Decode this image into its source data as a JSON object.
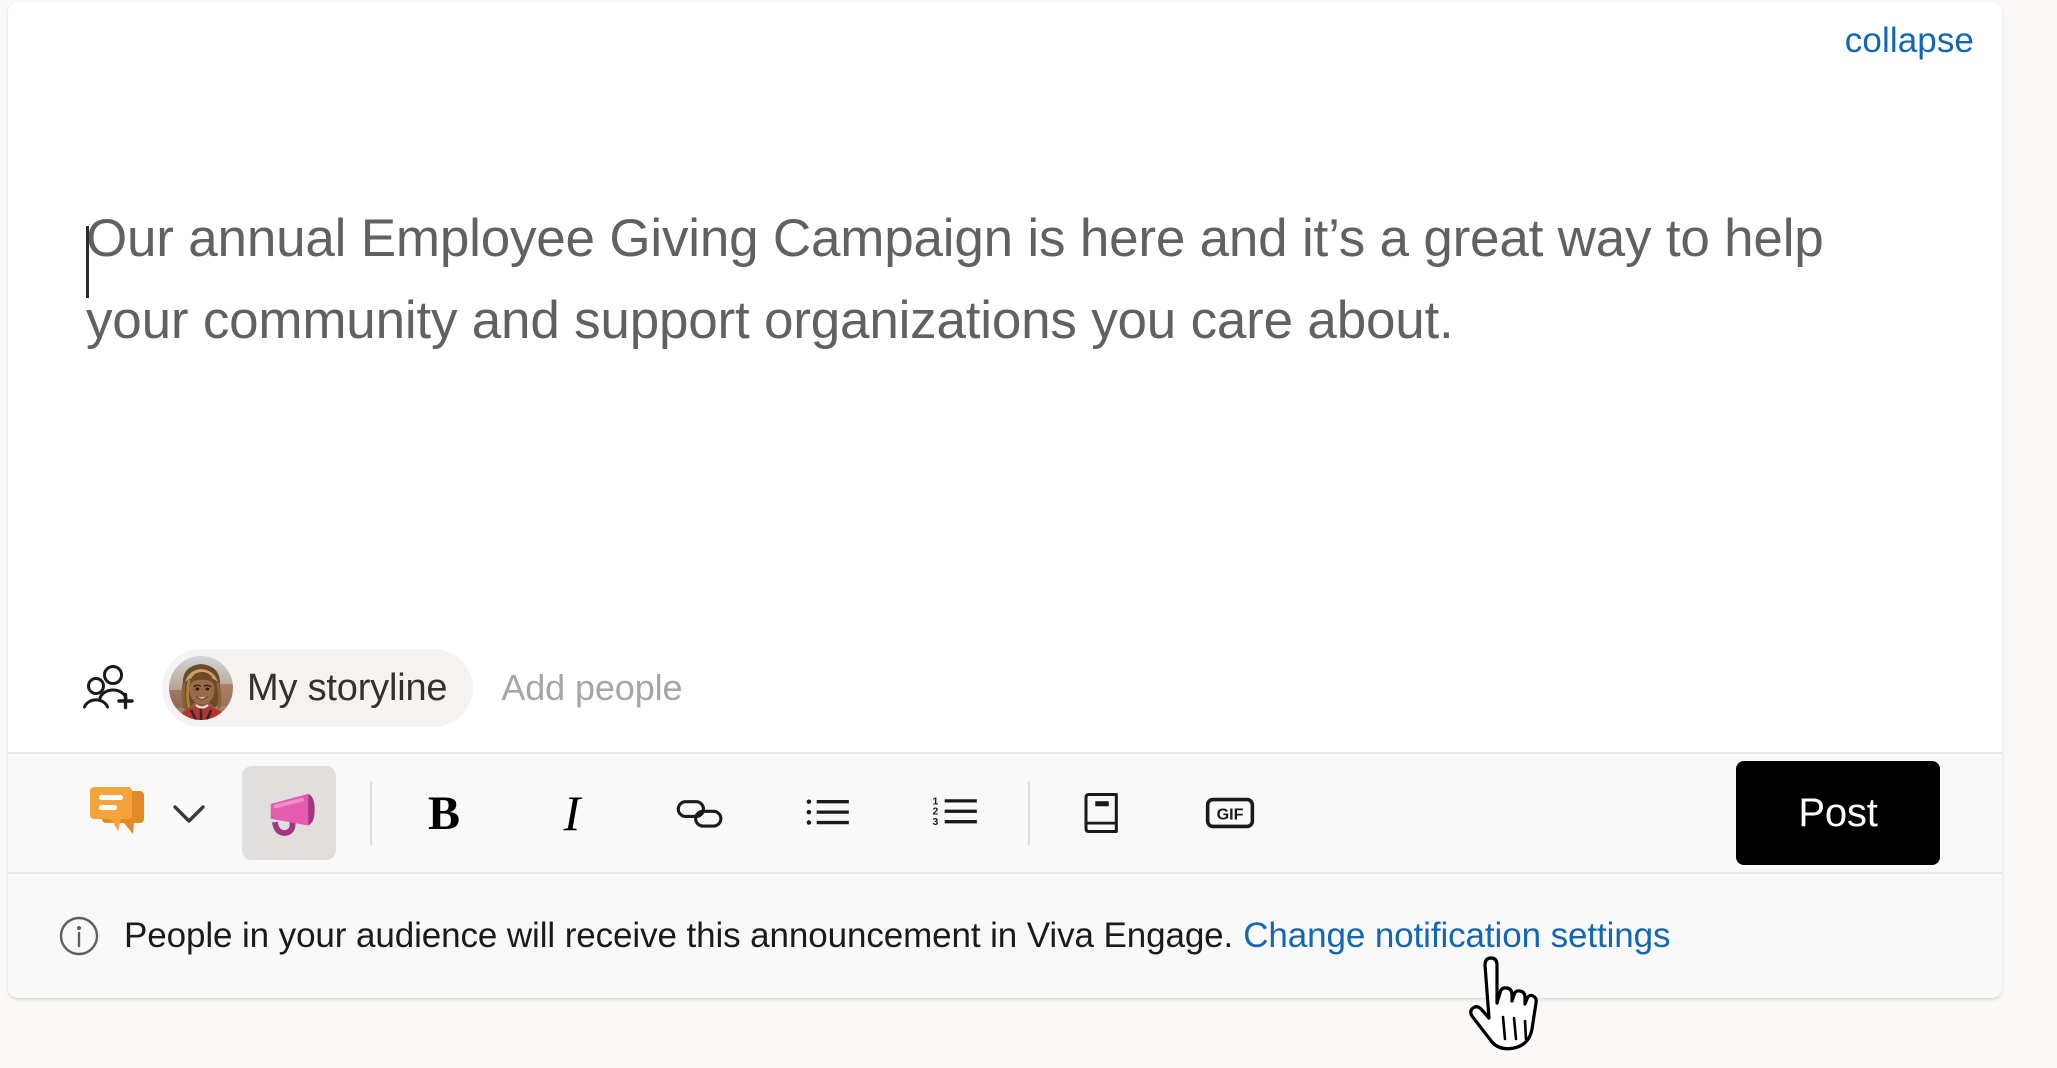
{
  "card": {
    "collapse_label": "collapse"
  },
  "message": {
    "text": "Our annual Employee Giving Campaign is here and it’s a great way to help your community and support organizations you care about.",
    "caret_visible": true
  },
  "audience": {
    "add_audience_icon": "add-people-icon",
    "chip_label": "My storyline",
    "chip_avatar_icon": "user-avatar-photo",
    "add_people_placeholder": "Add people"
  },
  "toolbar": {
    "post_type_icon": "discussion-bubble-icon",
    "post_type_chevron_icon": "chevron-down-icon",
    "announcement_icon": "megaphone-icon",
    "announcement_selected": true,
    "bold_label": "B",
    "italic_label": "I",
    "link_icon": "link-chain-icon",
    "bulleted_list_icon": "bulleted-list-icon",
    "numbered_list_icon": "numbered-list-icon",
    "praise_icon": "praise-book-icon",
    "gif_label": "GIF",
    "post_label": "Post"
  },
  "notification": {
    "info_icon": "info-circle-icon",
    "text": "People in your audience will receive this announcement in Viva Engage.",
    "link_label": "Change notification settings"
  },
  "cursor": {
    "icon": "pointing-hand-cursor"
  },
  "colors": {
    "link_blue": "#1267b4",
    "post_button_bg": "#000000",
    "announcement_pink": "#e45bb0",
    "announcement_pink_dark": "#a33581",
    "discussion_orange": "#f2a33c",
    "selected_bg": "#e1dfdd",
    "toolbar_bg": "#f9f9f9",
    "message_text": "#616161"
  }
}
